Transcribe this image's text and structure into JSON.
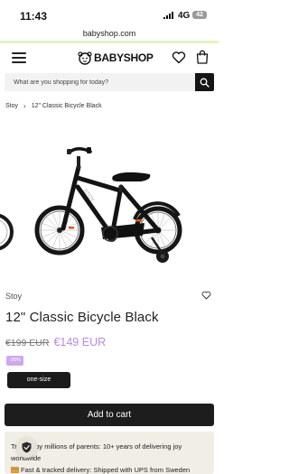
{
  "status_bar": {
    "time": "11:43",
    "network": "4G",
    "battery": "42"
  },
  "browser": {
    "url": "babyshop.com"
  },
  "header": {
    "logo_text": "BABYSHOP"
  },
  "search": {
    "placeholder": "What are you shopping for today?"
  },
  "breadcrumb": {
    "items": [
      "Stoy",
      "12\" Classic Bicycle Black"
    ]
  },
  "product": {
    "brand": "Stoy",
    "title": "12\" Classic Bicycle Black",
    "old_price": "€199 EUR",
    "new_price": "€149 EUR",
    "discount": "-25%",
    "size": "one-size",
    "add_to_cart": "Add to cart"
  },
  "usps": {
    "line1": "Trusted by millions of parents: 10+ years of delivering joy worldwide",
    "line2": "Fast & tracked delivery: Shipped with UPS from Sweden"
  },
  "colors": {
    "price_accent": "#b88ae4",
    "discount_badge": "#cda8ee",
    "button": "#1d1d1d",
    "accent_line": "#e4f5c2",
    "usp_background": "#f1eee6"
  },
  "icons": [
    "signal-icon",
    "menu-icon",
    "logo-baby-icon",
    "heart-icon",
    "shopping-bag-icon",
    "search-icon",
    "chevron-right-icon",
    "wishlist-heart-icon",
    "shield-check-icon",
    "delivery-box-icon"
  ]
}
